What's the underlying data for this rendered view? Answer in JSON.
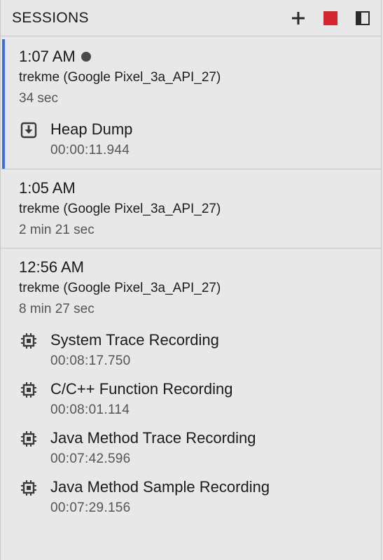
{
  "header": {
    "title": "SESSIONS",
    "actions": [
      {
        "icon": "plus-icon"
      },
      {
        "icon": "stop-icon",
        "color": "#d4262f"
      },
      {
        "icon": "panel-toggle-icon"
      }
    ]
  },
  "sessions": [
    {
      "time": "1:07 AM",
      "live": true,
      "device": "trekme (Google Pixel_3a_API_27)",
      "duration": "34 sec",
      "artifacts": [
        {
          "icon": "heap-dump-icon",
          "name": "Heap Dump",
          "time": "00:00:11.944"
        }
      ]
    },
    {
      "time": "1:05 AM",
      "device": "trekme (Google Pixel_3a_API_27)",
      "duration": "2 min 21 sec"
    },
    {
      "time": "12:56 AM",
      "device": "trekme (Google Pixel_3a_API_27)",
      "duration": "8 min 27 sec",
      "artifacts": [
        {
          "icon": "cpu-recording-icon",
          "name": "System Trace Recording",
          "time": "00:08:17.750"
        },
        {
          "icon": "cpu-recording-icon",
          "name": "C/C++ Function Recording",
          "time": "00:08:01.114"
        },
        {
          "icon": "cpu-recording-icon",
          "name": "Java Method Trace Recording",
          "time": "00:07:42.596"
        },
        {
          "icon": "cpu-recording-icon",
          "name": "Java Method Sample Recording",
          "time": "00:07:29.156"
        }
      ]
    }
  ],
  "colors": {
    "accent": "#3f6ed8",
    "stop": "#d4262f",
    "background": "#e8e8e8"
  }
}
